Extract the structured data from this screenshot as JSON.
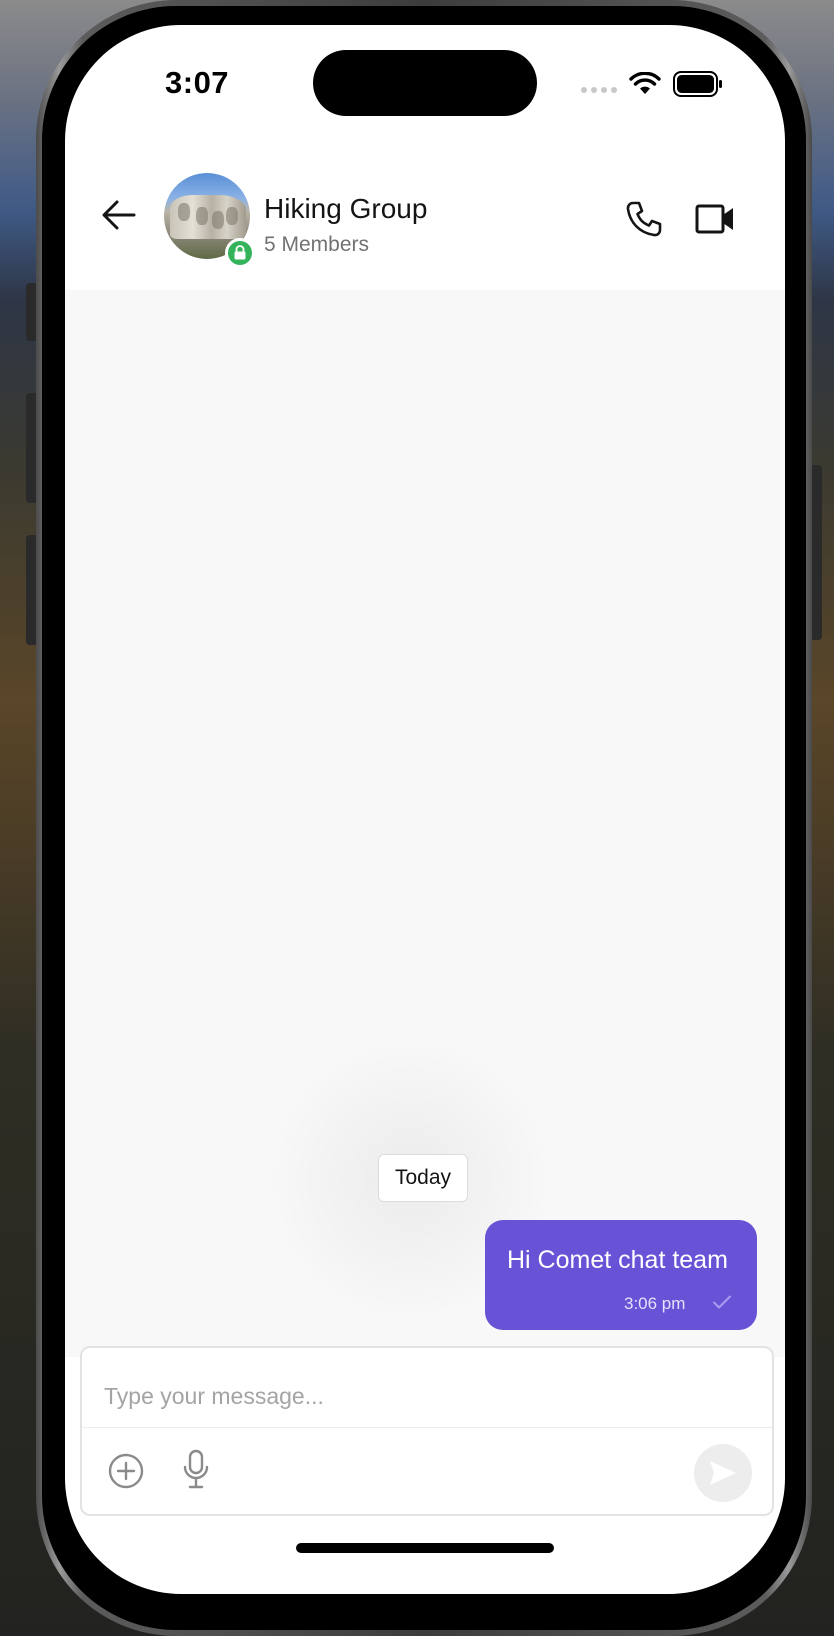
{
  "status_bar": {
    "time": "3:07"
  },
  "header": {
    "title": "Hiking Group",
    "subtitle": "5 Members",
    "icons": {
      "back": "back-arrow-icon",
      "call": "phone-icon",
      "video": "video-camera-icon",
      "badge": "lock-icon"
    }
  },
  "messages": {
    "date_separator": "Today",
    "items": [
      {
        "text": "Hi Comet chat team",
        "time": "3:06 pm",
        "status": "sent"
      }
    ]
  },
  "composer": {
    "placeholder": "Type your message...",
    "icons": {
      "add": "plus-circle-icon",
      "mic": "microphone-icon",
      "send": "send-icon"
    }
  },
  "colors": {
    "accent": "#6852d6",
    "online_badge": "#34b35a",
    "background": "#f8f8f8"
  }
}
